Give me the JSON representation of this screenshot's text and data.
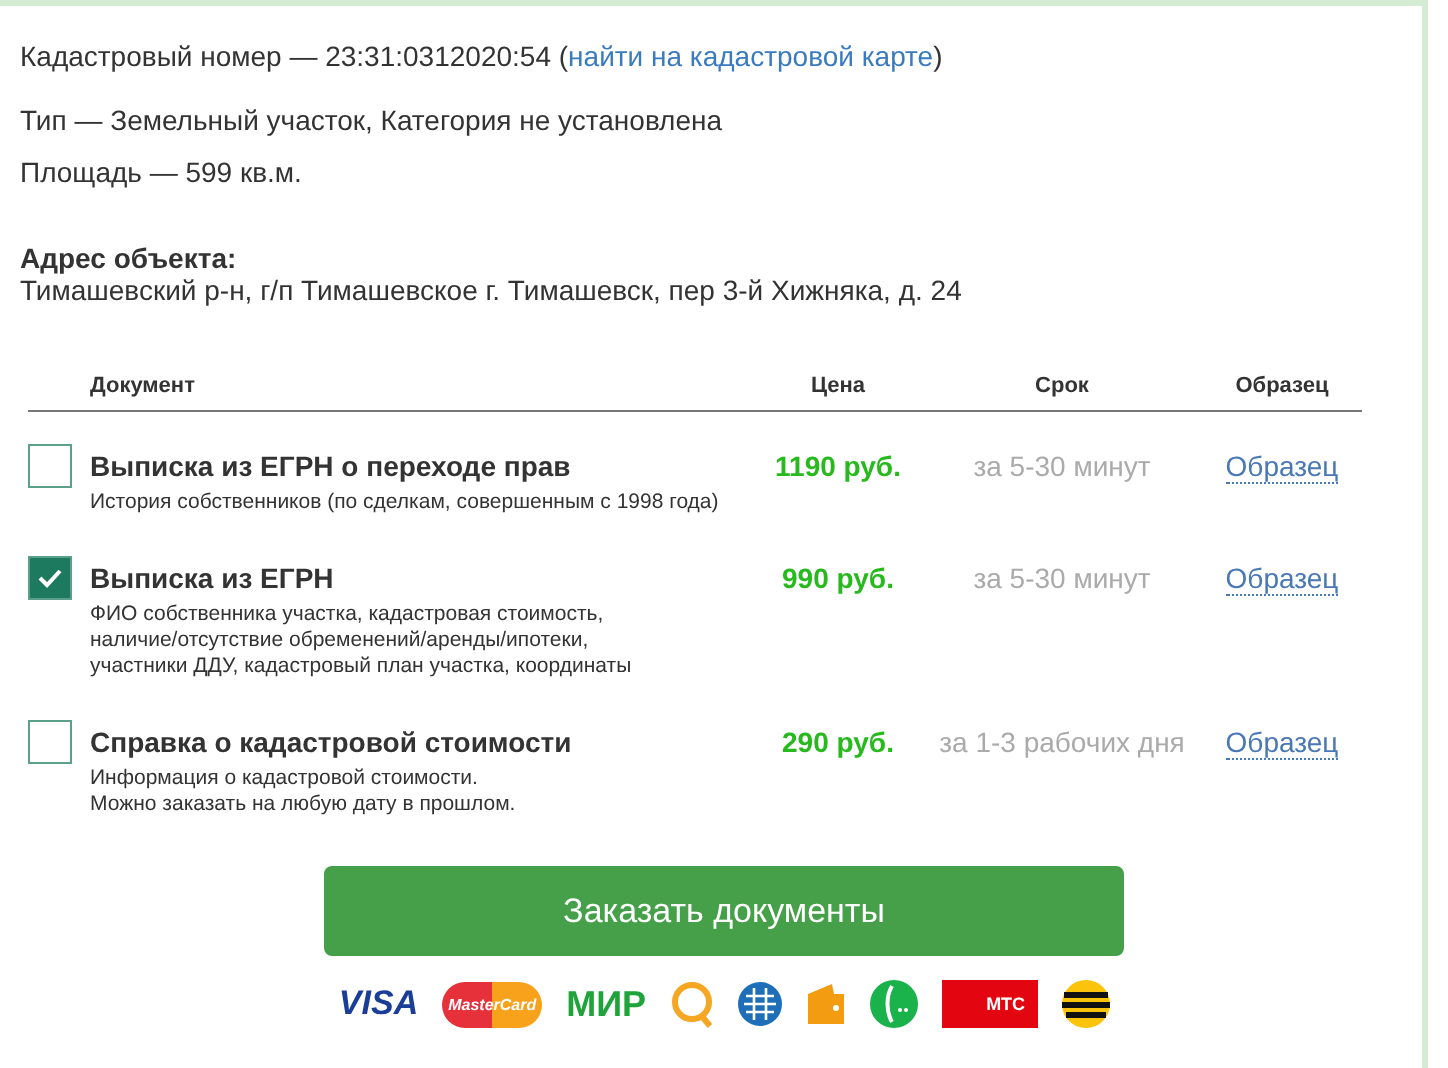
{
  "cadastral": {
    "label": "Кадастровый номер — 23:31:0312020:54",
    "open_paren": "(",
    "link": "найти на кадастровой карте",
    "close_paren": ")"
  },
  "type_line": "Тип — Земельный участок, Категория не установлена",
  "area_line": "Площадь — 599 кв.м.",
  "address": {
    "label": "Адрес объекта:",
    "value": "Тимашевский р-н, г/п Тимашевское г. Тимашевск, пер 3-й Хижняка, д. 24"
  },
  "table": {
    "columns": [
      "Документ",
      "Цена",
      "Срок",
      "Образец"
    ],
    "rows": [
      {
        "checked": false,
        "title": "Выписка из ЕГРН о переходе прав",
        "description": [
          "История собственников (по сделкам, совершенным с 1998 года)"
        ],
        "price": "1190 руб.",
        "term": "за 5-30 минут",
        "sample": "Образец"
      },
      {
        "checked": true,
        "title": "Выписка из ЕГРН",
        "description": [
          "ФИО собственника участка, кадастровая стоимость,",
          "наличие/отсутствие обременений/аренды/ипотеки,",
          "участники ДДУ, кадастровый план участка, координаты"
        ],
        "price": "990 руб.",
        "term": "за 5-30 минут",
        "sample": "Образец"
      },
      {
        "checked": false,
        "title": "Справка о кадастровой стоимости",
        "description": [
          "Информация о кадастровой стоимости.",
          "Можно заказать на любую дату в прошлом."
        ],
        "price": "290 руб.",
        "term": "за 1-3 рабочих дня",
        "sample": "Образец"
      }
    ]
  },
  "order_button": "Заказать документы",
  "payment_methods": [
    {
      "kind": "visa",
      "label": "VISA"
    },
    {
      "kind": "mastercard",
      "label": "MasterCard"
    },
    {
      "kind": "mir",
      "label": "МИР"
    },
    {
      "kind": "qiwi"
    },
    {
      "kind": "webmoney"
    },
    {
      "kind": "wallet"
    },
    {
      "kind": "megafon"
    },
    {
      "kind": "mts",
      "label": "МТС"
    },
    {
      "kind": "beeline"
    }
  ]
}
